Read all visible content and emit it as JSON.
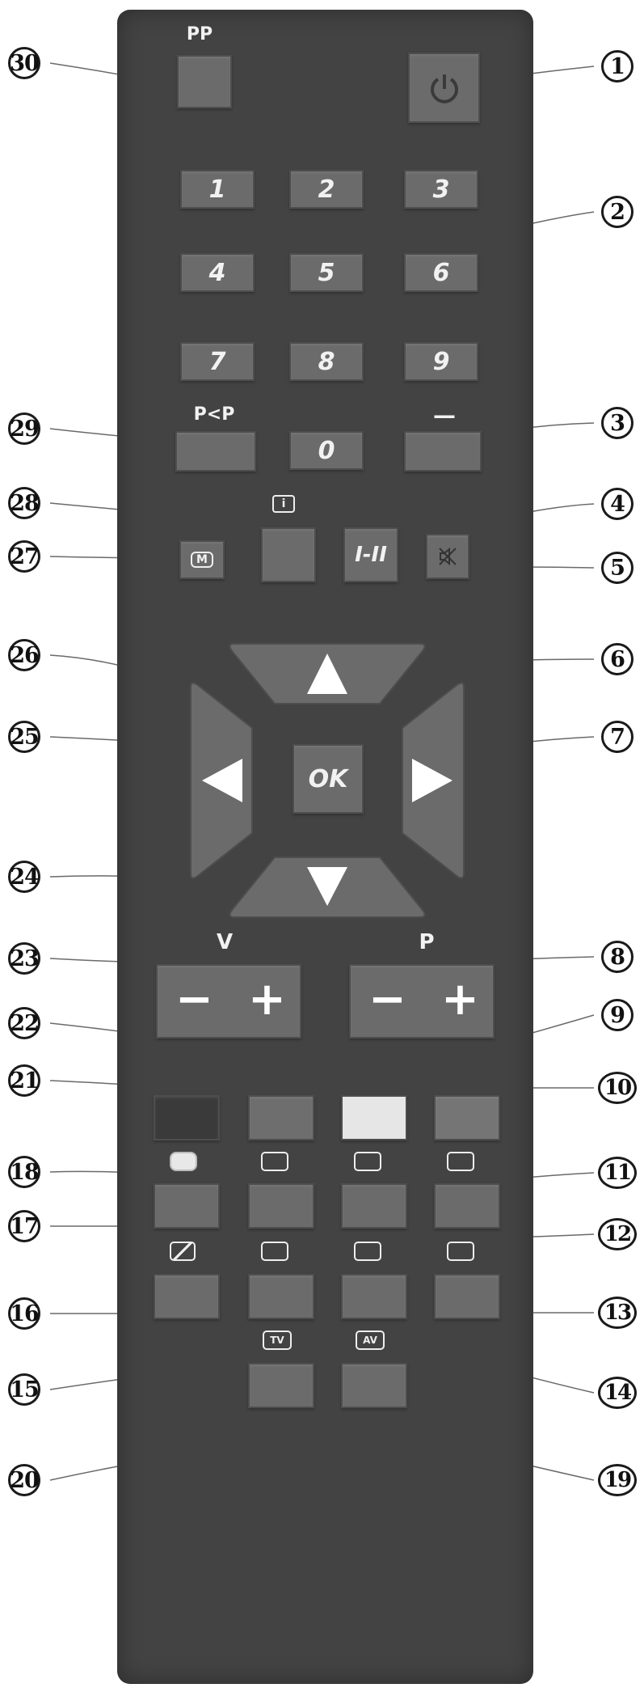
{
  "buttons": {
    "pp_label": "PP",
    "digits": [
      "1",
      "2",
      "3",
      "4",
      "5",
      "6",
      "7",
      "8",
      "9",
      "0"
    ],
    "pp_swap_label": "P<P",
    "dash_label": "—",
    "dual_label": "I-II",
    "ok_label": "OK",
    "v_label": "V",
    "p_label": "P",
    "minus": "−",
    "plus": "+"
  },
  "callouts": [
    "1",
    "2",
    "3",
    "4",
    "5",
    "6",
    "7",
    "8",
    "9",
    "10",
    "11",
    "12",
    "13",
    "14",
    "15",
    "16",
    "17",
    "18",
    "19",
    "20",
    "21",
    "22",
    "23",
    "24",
    "25",
    "26",
    "27",
    "28",
    "29",
    "30"
  ],
  "icons": {
    "menu_icon": "M",
    "tv_icon": "TV",
    "av_icon": "AV",
    "info_icon": "i"
  },
  "colors": {
    "remote_body": "#434343",
    "button": "#6b6b6b",
    "color_red": "#3a3a3a",
    "color_green": "#6e6e6e",
    "color_yellow": "#e6e6e6",
    "color_blue": "#757575"
  }
}
